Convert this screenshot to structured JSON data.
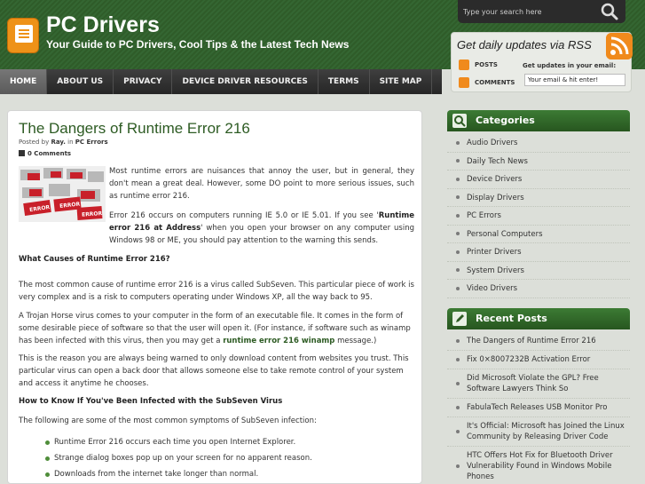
{
  "header": {
    "title": "PC Drivers",
    "tagline": "Your Guide to PC Drivers, Cool Tips & the Latest Tech News"
  },
  "search": {
    "placeholder": "Type your search here"
  },
  "rss": {
    "heading": "Get daily updates via RSS",
    "posts_label": "POSTS",
    "comments_label": "COMMENTS",
    "email_label": "Get updates in your email:",
    "email_placeholder": "Your email & hit enter!"
  },
  "nav": {
    "items": [
      "HOME",
      "ABOUT US",
      "PRIVACY",
      "DEVICE DRIVER RESOURCES",
      "TERMS",
      "SITE MAP"
    ]
  },
  "post": {
    "title": "The Dangers of Runtime Error 216",
    "meta_prefix": "Posted by",
    "author": "Ray.",
    "meta_in": "in",
    "category": "PC Errors",
    "comments": "0 Comments",
    "image_words": [
      "ERROR",
      "ERROR",
      "ERROR"
    ],
    "p1": "Most runtime errors are nuisances that annoy the user, but in general, they don't mean a great deal. However, some DO point to more serious issues, such as runtime error 216.",
    "p2_a": "Error 216 occurs on computers running IE 5.0 or IE 5.01. If you see '",
    "p2_bold": "Runtime error 216 at Address",
    "p2_b": "' when you open your browser on any computer using Windows 98 or ME, you should pay attention to the warning this sends.",
    "h1": "What Causes of Runtime Error 216?",
    "p3": "The most common cause of runtime error 216 is a virus called SubSeven. This particular piece of work is very complex and is a risk to computers operating under Windows XP, all the way back to 95.",
    "p4_a": "A Trojan Horse virus comes to your computer in the form of an executable file. It comes in the form of some desirable piece of software so that the user will open it. (For instance, if software such as winamp has been infected with this virus, then you may get a ",
    "p4_link": "runtime error 216 winamp",
    "p4_b": " message.)",
    "p5": "This is the reason you are always being warned to only download content from websites you trust. This particular virus can open a back door that allows someone else to take remote control of your system and access it anytime he chooses.",
    "h2": "How to Know If You've Been Infected with the SubSeven Virus",
    "p6": "The following are some of the most common symptoms of SubSeven infection:",
    "bullets": [
      "Runtime Error 216 occurs each time you open Internet Explorer.",
      "Strange dialog boxes pop up on your screen for no apparent reason.",
      "Downloads from the internet take longer than normal."
    ]
  },
  "categories": {
    "title": "Categories",
    "items": [
      "Audio Drivers",
      "Daily Tech News",
      "Device Drivers",
      "Display Drivers",
      "PC Errors",
      "Personal Computers",
      "Printer Drivers",
      "System Drivers",
      "Video Drivers"
    ]
  },
  "recent": {
    "title": "Recent Posts",
    "items": [
      "The Dangers of Runtime Error 216",
      "Fix 0×8007232B Activation Error",
      "Did Microsoft Violate the GPL? Free Software Lawyers Think So",
      "FabulaTech Releases USB Monitor Pro",
      "It's Official: Microsoft has Joined the Linux Community by Releasing Driver Code",
      "HTC Offers Hot Fix for Bluetooth Driver Vulnerability Found in Windows Mobile Phones"
    ]
  },
  "colors": {
    "header_green": "#2f5c29",
    "accent_green": "#2d5b23",
    "rss_orange": "#f08a1c",
    "nav_dark": "#2f2f2f"
  }
}
